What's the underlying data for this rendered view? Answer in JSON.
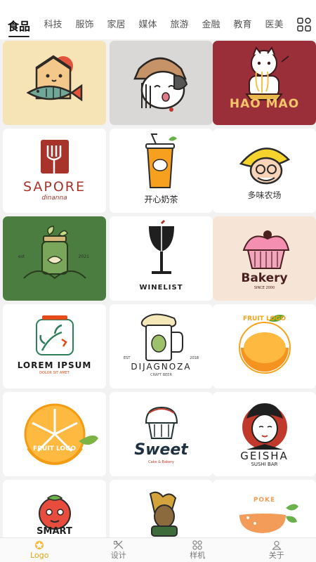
{
  "tabs": [
    {
      "label": "食品",
      "active": true
    },
    {
      "label": "科技"
    },
    {
      "label": "服饰"
    },
    {
      "label": "家居"
    },
    {
      "label": "媒体"
    },
    {
      "label": "旅游"
    },
    {
      "label": "金融"
    },
    {
      "label": "教育"
    },
    {
      "label": "医美"
    }
  ],
  "logos": {
    "hao_mao": "HAO MAO",
    "sapore": "SAPORE",
    "sapore_sub": "dinanna",
    "kaixin": "开心奶茶",
    "duowei": "多味农场",
    "est": "est",
    "year": "2021",
    "winelist": "WINELIST",
    "bakery": "Bakery",
    "bakery_since": "SINCE 2000",
    "lorem": "LOREM IPSUM",
    "lorem_sub": "DOLOR SIT AMET",
    "dijagnoza": "DIJAGNOZA",
    "dijagnoza_sub": "CRAFT BEER",
    "dij_est": "EST",
    "dij_year": "2018",
    "fruit_logo": "FRUIT LOGO",
    "sweet": "Sweet",
    "sweet_sub": "Cake & Bakery",
    "geisha": "GEISHA",
    "geisha_sub": "SUSHI BAR",
    "smart": "SMART",
    "poke": "POKE"
  },
  "bottom_nav": [
    {
      "label": "Logo",
      "icon": "logo-icon",
      "active": true
    },
    {
      "label": "设计",
      "icon": "design-icon"
    },
    {
      "label": "样机",
      "icon": "mockup-icon"
    },
    {
      "label": "关于",
      "icon": "about-icon"
    }
  ],
  "colors": {
    "accent": "#e8a317",
    "maroon": "#9a2f3a",
    "green": "#4a7d3f",
    "tab_active": "#111111"
  }
}
